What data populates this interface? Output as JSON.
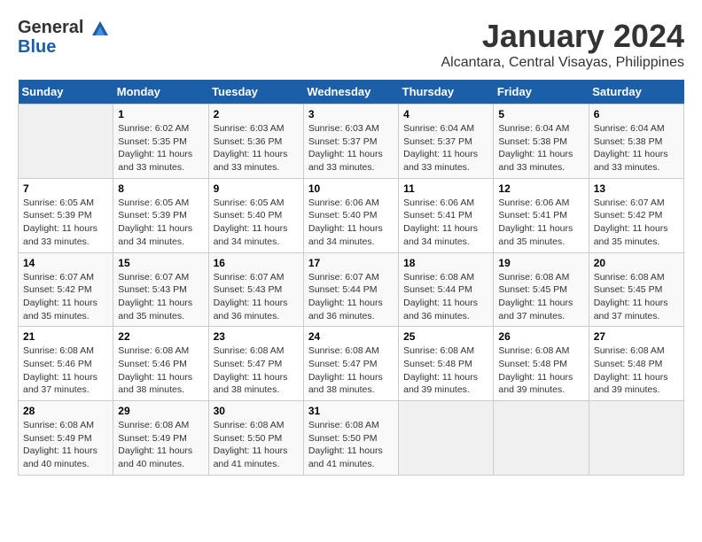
{
  "header": {
    "logo_line1": "General",
    "logo_line2": "Blue",
    "month": "January 2024",
    "location": "Alcantara, Central Visayas, Philippines"
  },
  "days_of_week": [
    "Sunday",
    "Monday",
    "Tuesday",
    "Wednesday",
    "Thursday",
    "Friday",
    "Saturday"
  ],
  "weeks": [
    [
      {
        "day": "",
        "sunrise": "",
        "sunset": "",
        "daylight": ""
      },
      {
        "day": "1",
        "sunrise": "Sunrise: 6:02 AM",
        "sunset": "Sunset: 5:35 PM",
        "daylight": "Daylight: 11 hours and 33 minutes."
      },
      {
        "day": "2",
        "sunrise": "Sunrise: 6:03 AM",
        "sunset": "Sunset: 5:36 PM",
        "daylight": "Daylight: 11 hours and 33 minutes."
      },
      {
        "day": "3",
        "sunrise": "Sunrise: 6:03 AM",
        "sunset": "Sunset: 5:37 PM",
        "daylight": "Daylight: 11 hours and 33 minutes."
      },
      {
        "day": "4",
        "sunrise": "Sunrise: 6:04 AM",
        "sunset": "Sunset: 5:37 PM",
        "daylight": "Daylight: 11 hours and 33 minutes."
      },
      {
        "day": "5",
        "sunrise": "Sunrise: 6:04 AM",
        "sunset": "Sunset: 5:38 PM",
        "daylight": "Daylight: 11 hours and 33 minutes."
      },
      {
        "day": "6",
        "sunrise": "Sunrise: 6:04 AM",
        "sunset": "Sunset: 5:38 PM",
        "daylight": "Daylight: 11 hours and 33 minutes."
      }
    ],
    [
      {
        "day": "7",
        "sunrise": "Sunrise: 6:05 AM",
        "sunset": "Sunset: 5:39 PM",
        "daylight": "Daylight: 11 hours and 33 minutes."
      },
      {
        "day": "8",
        "sunrise": "Sunrise: 6:05 AM",
        "sunset": "Sunset: 5:39 PM",
        "daylight": "Daylight: 11 hours and 34 minutes."
      },
      {
        "day": "9",
        "sunrise": "Sunrise: 6:05 AM",
        "sunset": "Sunset: 5:40 PM",
        "daylight": "Daylight: 11 hours and 34 minutes."
      },
      {
        "day": "10",
        "sunrise": "Sunrise: 6:06 AM",
        "sunset": "Sunset: 5:40 PM",
        "daylight": "Daylight: 11 hours and 34 minutes."
      },
      {
        "day": "11",
        "sunrise": "Sunrise: 6:06 AM",
        "sunset": "Sunset: 5:41 PM",
        "daylight": "Daylight: 11 hours and 34 minutes."
      },
      {
        "day": "12",
        "sunrise": "Sunrise: 6:06 AM",
        "sunset": "Sunset: 5:41 PM",
        "daylight": "Daylight: 11 hours and 35 minutes."
      },
      {
        "day": "13",
        "sunrise": "Sunrise: 6:07 AM",
        "sunset": "Sunset: 5:42 PM",
        "daylight": "Daylight: 11 hours and 35 minutes."
      }
    ],
    [
      {
        "day": "14",
        "sunrise": "Sunrise: 6:07 AM",
        "sunset": "Sunset: 5:42 PM",
        "daylight": "Daylight: 11 hours and 35 minutes."
      },
      {
        "day": "15",
        "sunrise": "Sunrise: 6:07 AM",
        "sunset": "Sunset: 5:43 PM",
        "daylight": "Daylight: 11 hours and 35 minutes."
      },
      {
        "day": "16",
        "sunrise": "Sunrise: 6:07 AM",
        "sunset": "Sunset: 5:43 PM",
        "daylight": "Daylight: 11 hours and 36 minutes."
      },
      {
        "day": "17",
        "sunrise": "Sunrise: 6:07 AM",
        "sunset": "Sunset: 5:44 PM",
        "daylight": "Daylight: 11 hours and 36 minutes."
      },
      {
        "day": "18",
        "sunrise": "Sunrise: 6:08 AM",
        "sunset": "Sunset: 5:44 PM",
        "daylight": "Daylight: 11 hours and 36 minutes."
      },
      {
        "day": "19",
        "sunrise": "Sunrise: 6:08 AM",
        "sunset": "Sunset: 5:45 PM",
        "daylight": "Daylight: 11 hours and 37 minutes."
      },
      {
        "day": "20",
        "sunrise": "Sunrise: 6:08 AM",
        "sunset": "Sunset: 5:45 PM",
        "daylight": "Daylight: 11 hours and 37 minutes."
      }
    ],
    [
      {
        "day": "21",
        "sunrise": "Sunrise: 6:08 AM",
        "sunset": "Sunset: 5:46 PM",
        "daylight": "Daylight: 11 hours and 37 minutes."
      },
      {
        "day": "22",
        "sunrise": "Sunrise: 6:08 AM",
        "sunset": "Sunset: 5:46 PM",
        "daylight": "Daylight: 11 hours and 38 minutes."
      },
      {
        "day": "23",
        "sunrise": "Sunrise: 6:08 AM",
        "sunset": "Sunset: 5:47 PM",
        "daylight": "Daylight: 11 hours and 38 minutes."
      },
      {
        "day": "24",
        "sunrise": "Sunrise: 6:08 AM",
        "sunset": "Sunset: 5:47 PM",
        "daylight": "Daylight: 11 hours and 38 minutes."
      },
      {
        "day": "25",
        "sunrise": "Sunrise: 6:08 AM",
        "sunset": "Sunset: 5:48 PM",
        "daylight": "Daylight: 11 hours and 39 minutes."
      },
      {
        "day": "26",
        "sunrise": "Sunrise: 6:08 AM",
        "sunset": "Sunset: 5:48 PM",
        "daylight": "Daylight: 11 hours and 39 minutes."
      },
      {
        "day": "27",
        "sunrise": "Sunrise: 6:08 AM",
        "sunset": "Sunset: 5:48 PM",
        "daylight": "Daylight: 11 hours and 39 minutes."
      }
    ],
    [
      {
        "day": "28",
        "sunrise": "Sunrise: 6:08 AM",
        "sunset": "Sunset: 5:49 PM",
        "daylight": "Daylight: 11 hours and 40 minutes."
      },
      {
        "day": "29",
        "sunrise": "Sunrise: 6:08 AM",
        "sunset": "Sunset: 5:49 PM",
        "daylight": "Daylight: 11 hours and 40 minutes."
      },
      {
        "day": "30",
        "sunrise": "Sunrise: 6:08 AM",
        "sunset": "Sunset: 5:50 PM",
        "daylight": "Daylight: 11 hours and 41 minutes."
      },
      {
        "day": "31",
        "sunrise": "Sunrise: 6:08 AM",
        "sunset": "Sunset: 5:50 PM",
        "daylight": "Daylight: 11 hours and 41 minutes."
      },
      {
        "day": "",
        "sunrise": "",
        "sunset": "",
        "daylight": ""
      },
      {
        "day": "",
        "sunrise": "",
        "sunset": "",
        "daylight": ""
      },
      {
        "day": "",
        "sunrise": "",
        "sunset": "",
        "daylight": ""
      }
    ]
  ]
}
